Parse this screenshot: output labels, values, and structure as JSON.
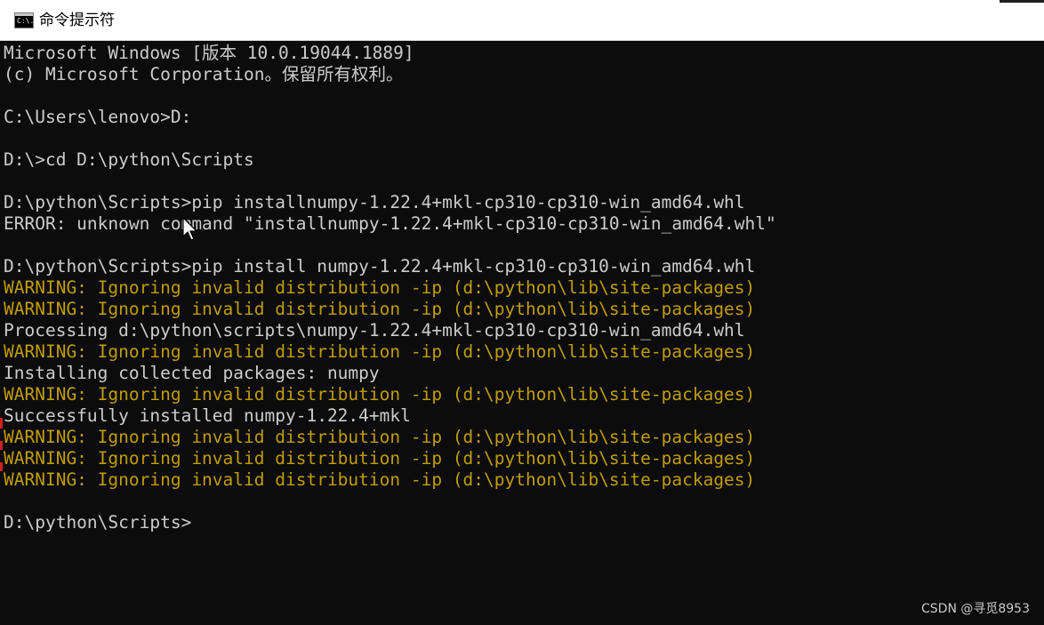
{
  "window": {
    "title": "命令提示符",
    "icon": "console-app-icon",
    "icon_glyph": "C:\\."
  },
  "console": {
    "lines": [
      {
        "text": "Microsoft Windows [版本 10.0.19044.1889]",
        "type": "normal"
      },
      {
        "text": "(c) Microsoft Corporation。保留所有权利。",
        "type": "normal"
      },
      {
        "text": "",
        "type": "normal"
      },
      {
        "text": "C:\\Users\\lenovo>D:",
        "type": "normal"
      },
      {
        "text": "",
        "type": "normal"
      },
      {
        "text": "D:\\>cd D:\\python\\Scripts",
        "type": "normal"
      },
      {
        "text": "",
        "type": "normal"
      },
      {
        "text": "D:\\python\\Scripts>pip installnumpy-1.22.4+mkl-cp310-cp310-win_amd64.whl",
        "type": "normal"
      },
      {
        "text": "ERROR: unknown command \"installnumpy-1.22.4+mkl-cp310-cp310-win_amd64.whl\"",
        "type": "normal"
      },
      {
        "text": "",
        "type": "normal"
      },
      {
        "text": "D:\\python\\Scripts>pip install numpy-1.22.4+mkl-cp310-cp310-win_amd64.whl",
        "type": "normal"
      },
      {
        "text": "WARNING: Ignoring invalid distribution -ip (d:\\python\\lib\\site-packages)",
        "type": "warn"
      },
      {
        "text": "WARNING: Ignoring invalid distribution -ip (d:\\python\\lib\\site-packages)",
        "type": "warn"
      },
      {
        "text": "Processing d:\\python\\scripts\\numpy-1.22.4+mkl-cp310-cp310-win_amd64.whl",
        "type": "normal"
      },
      {
        "text": "WARNING: Ignoring invalid distribution -ip (d:\\python\\lib\\site-packages)",
        "type": "warn"
      },
      {
        "text": "Installing collected packages: numpy",
        "type": "normal"
      },
      {
        "text": "WARNING: Ignoring invalid distribution -ip (d:\\python\\lib\\site-packages)",
        "type": "warn"
      },
      {
        "text": "Successfully installed numpy-1.22.4+mkl",
        "type": "normal"
      },
      {
        "text": "WARNING: Ignoring invalid distribution -ip (d:\\python\\lib\\site-packages)",
        "type": "warn"
      },
      {
        "text": "WARNING: Ignoring invalid distribution -ip (d:\\python\\lib\\site-packages)",
        "type": "warn"
      },
      {
        "text": "WARNING: Ignoring invalid distribution -ip (d:\\python\\lib\\site-packages)",
        "type": "warn"
      },
      {
        "text": "",
        "type": "normal"
      },
      {
        "text": "D:\\python\\Scripts>",
        "type": "normal"
      }
    ]
  },
  "cursor": {
    "icon": "mouse-pointer-icon"
  },
  "watermark": {
    "text": "CSDN @寻觅8953"
  },
  "colors": {
    "background": "#0c0c0c",
    "text": "#cccccc",
    "warning": "#c19c00",
    "titlebar": "#ffffff"
  }
}
